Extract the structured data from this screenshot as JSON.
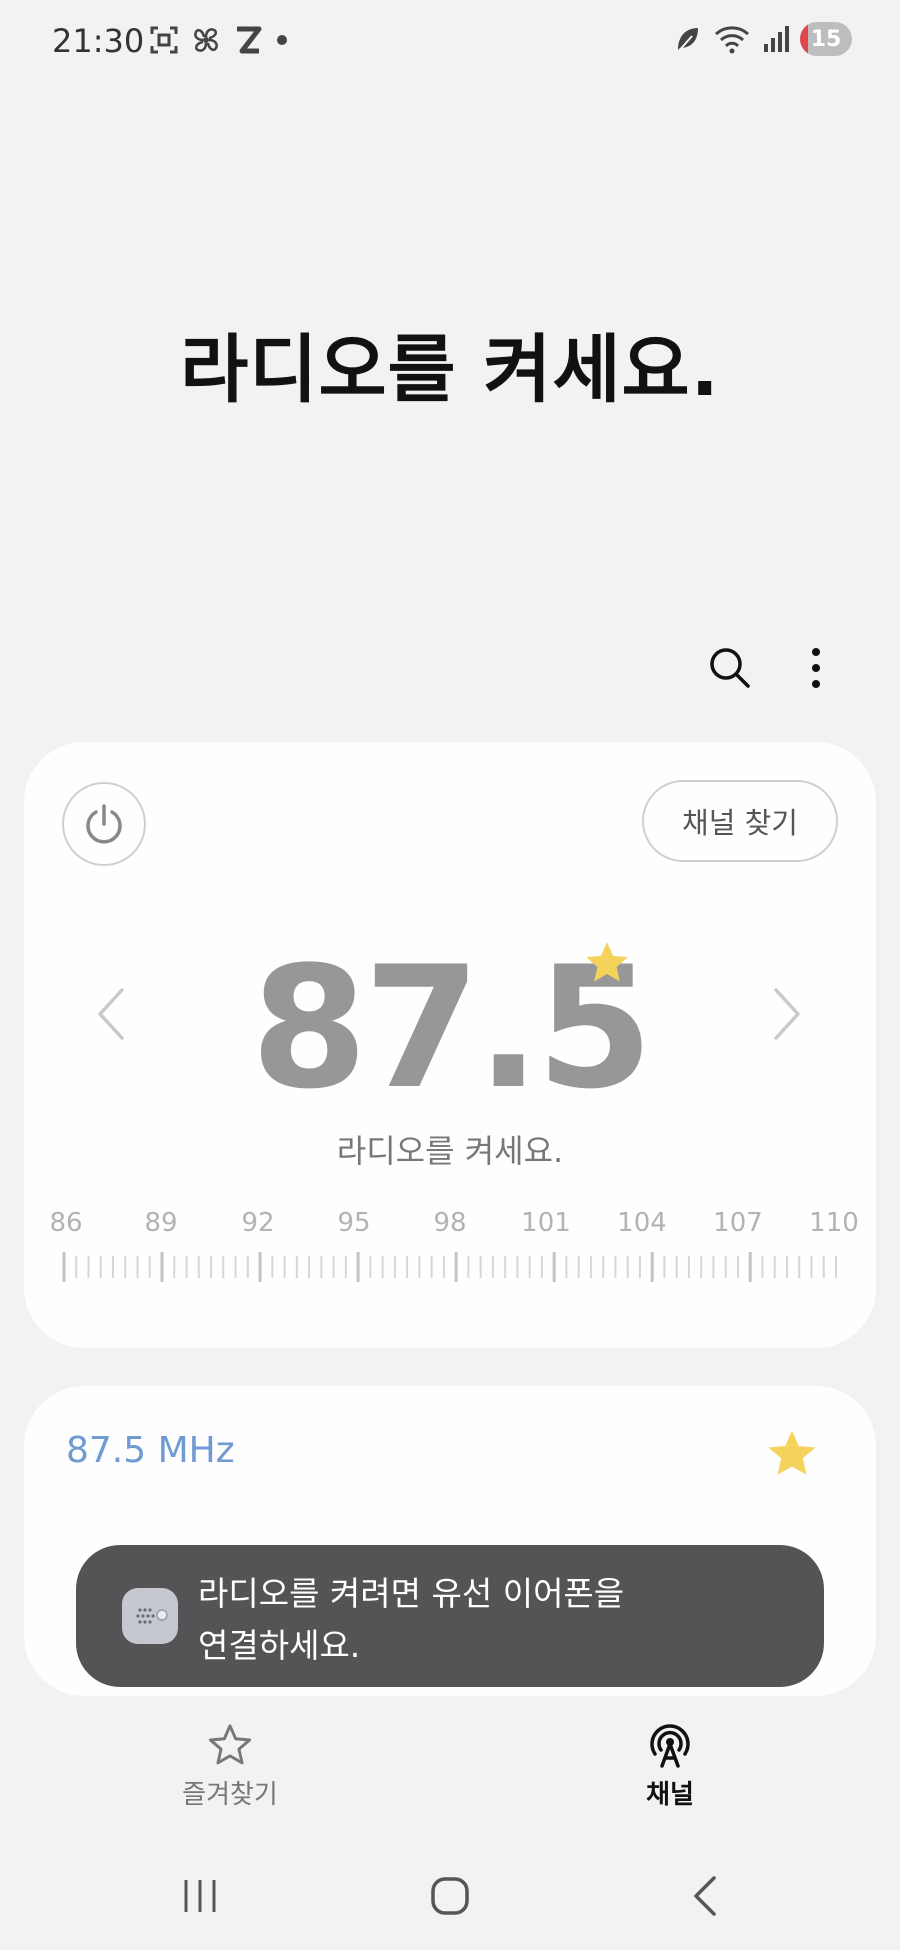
{
  "status_bar": {
    "time": "21:30",
    "battery_level": "15",
    "icons_left": [
      "screenshot-icon",
      "fan-icon",
      "z-app-icon",
      "dot-icon"
    ],
    "icons_right": [
      "leaf-icon",
      "wifi-icon",
      "signal-icon",
      "battery-icon"
    ]
  },
  "headline": "라디오를 켜세요.",
  "toolbar": {
    "icons": [
      "search-icon",
      "more-vertical-icon"
    ]
  },
  "tuner": {
    "find_channel_label": "채널 찾기",
    "frequency": "87.5",
    "status_text": "라디오를 켜세요.",
    "favorite": true,
    "scale_labels": [
      "86",
      "89",
      "92",
      "95",
      "98",
      "101",
      "104",
      "107",
      "110"
    ]
  },
  "station": {
    "frequency_label": "87.5 MHz",
    "favorite": true
  },
  "toast": {
    "text_line1": "라디오를 켜려면 유선 이어폰을",
    "text_line2": "연결하세요."
  },
  "bottom_nav": {
    "favorites_label": "즐겨찾기",
    "channels_label": "채널",
    "active": "채널"
  },
  "colors": {
    "background": "#f2f2f4",
    "card": "#fefefe",
    "frequency_text": "#979797",
    "star": "#f5d25a",
    "station_freq": "#6f9ad2",
    "toast": "#545456"
  }
}
